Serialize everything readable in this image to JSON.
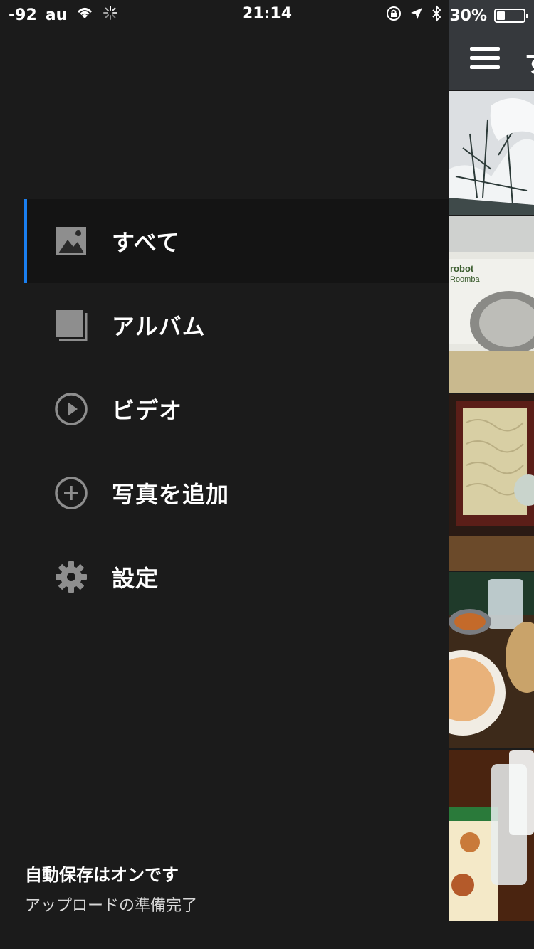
{
  "status_bar": {
    "signal": "-92",
    "carrier": "au",
    "time": "21:14",
    "battery_percent": "30%",
    "battery_level": 0.3,
    "icons": [
      "wifi-icon",
      "loading-spinner-icon",
      "rotation-lock-icon",
      "location-arrow-icon",
      "bluetooth-icon",
      "battery-icon"
    ]
  },
  "drawer": {
    "items": [
      {
        "label": "すべて",
        "icon": "image-icon",
        "active": true
      },
      {
        "label": "アルバム",
        "icon": "album-stack-icon",
        "active": false
      },
      {
        "label": "ビデオ",
        "icon": "play-circle-icon",
        "active": false
      },
      {
        "label": "写真を追加",
        "icon": "add-circle-icon",
        "active": false
      },
      {
        "label": "設定",
        "icon": "gear-icon",
        "active": false
      }
    ],
    "footer": {
      "title": "自動保存はオンです",
      "subtitle": "アップロードの準備完了"
    }
  },
  "main": {
    "title": "す",
    "thumbnails": [
      "snowy-tree-photo",
      "robot-vacuum-box-photo",
      "soba-noodles-photo",
      "restaurant-table-photo",
      "menu-and-drinks-photo"
    ]
  },
  "colors": {
    "accent": "#1a7ff0",
    "drawer_bg": "#1b1b1b",
    "active_bg": "#141414",
    "header_bg": "#36393d",
    "icon_gray": "#8e8e8e"
  }
}
